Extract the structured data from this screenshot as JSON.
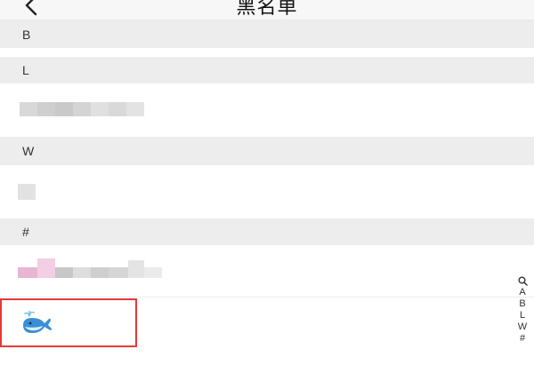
{
  "header": {
    "title": "黑名单",
    "back_icon": "chevron-left-icon"
  },
  "sections": [
    {
      "letter": "B"
    },
    {
      "letter": "L"
    },
    {
      "letter": "W"
    },
    {
      "letter": "#"
    }
  ],
  "contacts": [
    {
      "section": "L",
      "name_display": "blurred"
    },
    {
      "section": "W",
      "name_display": "blurred"
    },
    {
      "section": "#",
      "name_display": "blurred"
    },
    {
      "section": "#",
      "avatar": "whale-icon"
    }
  ],
  "index_bar": {
    "search_icon": "search-icon",
    "letters": [
      "A",
      "B",
      "L",
      "W",
      "#"
    ]
  },
  "colors": {
    "section_bg": "#ededed",
    "highlight": "#e53935",
    "whale": "#3a8fd6"
  }
}
